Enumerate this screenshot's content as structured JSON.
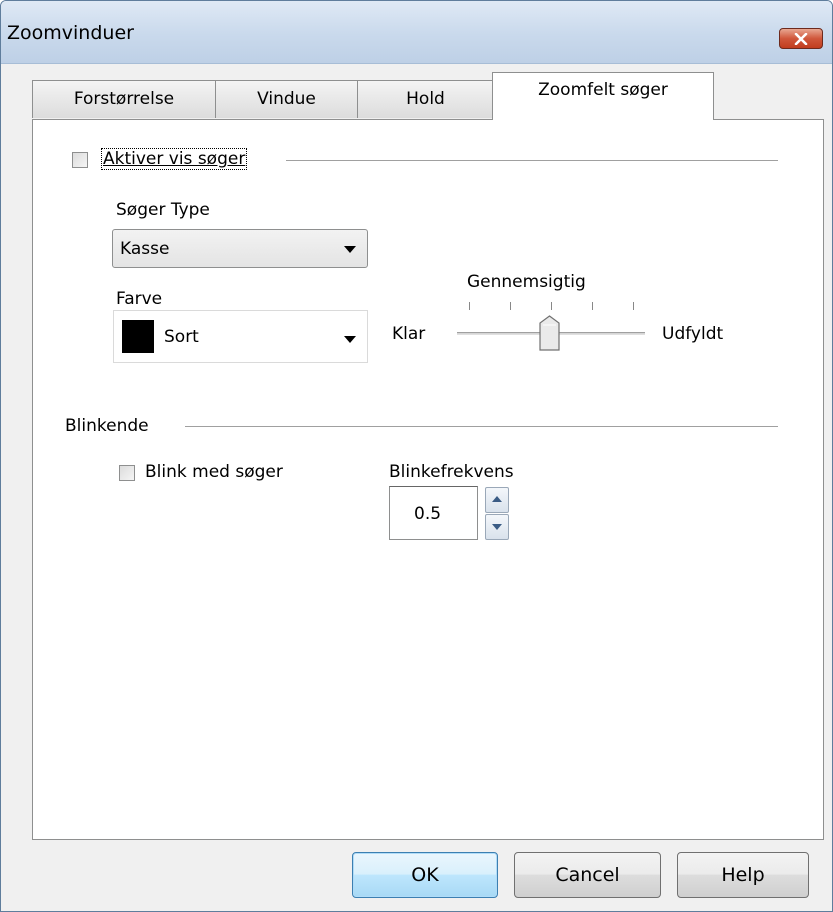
{
  "window": {
    "title": "Zoomvinduer",
    "close_icon": "close-icon"
  },
  "tabs": [
    {
      "label": "Forstørrelse",
      "active": false
    },
    {
      "label": "Vindue",
      "active": false
    },
    {
      "label": "Hold",
      "active": false
    },
    {
      "label": "Zoomfelt søger",
      "active": true
    }
  ],
  "locator": {
    "enable_label": "Aktiver vis søger",
    "enable_checked": false,
    "type_label": "Søger Type",
    "type_value": "Kasse",
    "color_label": "Farve",
    "color_value": "Sort",
    "color_swatch": "#000000",
    "transparency_label": "Gennemsigtig",
    "slider_min_label": "Klar",
    "slider_max_label": "Udfyldt",
    "slider_value_fraction": 0.5
  },
  "blinking": {
    "section_label": "Blinkende",
    "blink_label": "Blink med søger",
    "blink_checked": false,
    "frequency_label": "Blinkefrekvens",
    "frequency_value": "0.5"
  },
  "buttons": {
    "ok": "OK",
    "cancel": "Cancel",
    "help": "Help"
  },
  "colors": {
    "accent_default_button": "#3c7fb1",
    "close_button": "#c13d1e"
  }
}
